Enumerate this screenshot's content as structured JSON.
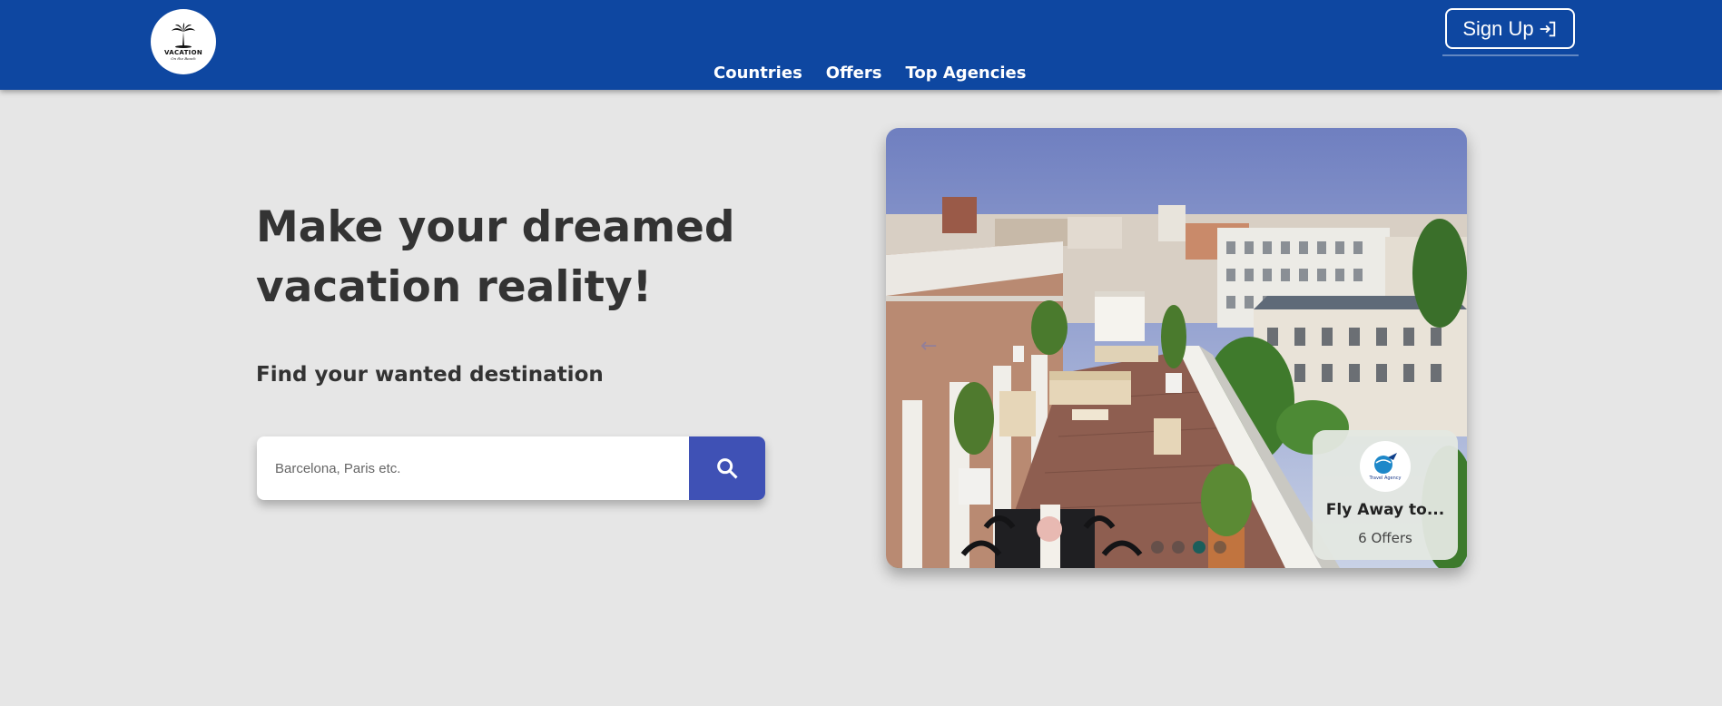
{
  "brand": {
    "logo_text": "VACATION",
    "logo_subtext": "On the Beach"
  },
  "nav": {
    "links": [
      "Countries",
      "Offers",
      "Top Agencies"
    ],
    "signup_label": "Sign Up"
  },
  "hero": {
    "headline": "Make your dreamed vacation reality!",
    "subheadline": "Find your wanted destination"
  },
  "search": {
    "placeholder": "Barcelona, Paris etc."
  },
  "carousel": {
    "prev_arrow": "←",
    "slide_count": 4,
    "active_slide": 3,
    "card": {
      "agency_logo_text": "Travel Agency",
      "title": "Fly Away to...",
      "offers": "6 Offers"
    }
  },
  "colors": {
    "navbar": "#0e47a1",
    "search_button": "#3f51b5",
    "background": "#e6e6e6"
  }
}
